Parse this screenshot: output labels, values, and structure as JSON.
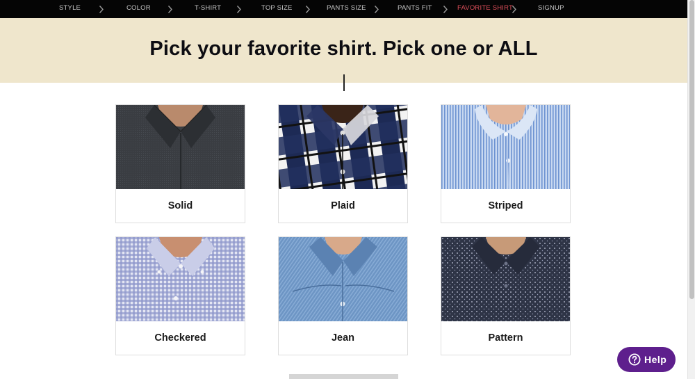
{
  "nav": {
    "steps": [
      {
        "label": "STYLE",
        "active": false
      },
      {
        "label": "COLOR",
        "active": false
      },
      {
        "label": "T-SHIRT",
        "active": false
      },
      {
        "label": "TOP SIZE",
        "active": false
      },
      {
        "label": "PANTS SIZE",
        "active": false
      },
      {
        "label": "PANTS FIT",
        "active": false
      },
      {
        "label": "FAVORITE SHIRT",
        "active": true
      },
      {
        "label": "SIGNUP",
        "active": false
      }
    ],
    "separator_icon": "chevron-right-icon"
  },
  "hero": {
    "title": "Pick your favorite shirt. Pick one or ALL"
  },
  "options": [
    {
      "label": "Solid"
    },
    {
      "label": "Plaid"
    },
    {
      "label": "Striped"
    },
    {
      "label": "Checkered"
    },
    {
      "label": "Jean"
    },
    {
      "label": "Pattern"
    }
  ],
  "help": {
    "label": "Help",
    "icon": "question-circle-icon"
  },
  "colors": {
    "nav_bg": "#050505",
    "nav_text": "#c8c8c8",
    "nav_active": "#e0505b",
    "hero_bg": "#efe6cc",
    "help_bg": "#5e1f8d"
  }
}
